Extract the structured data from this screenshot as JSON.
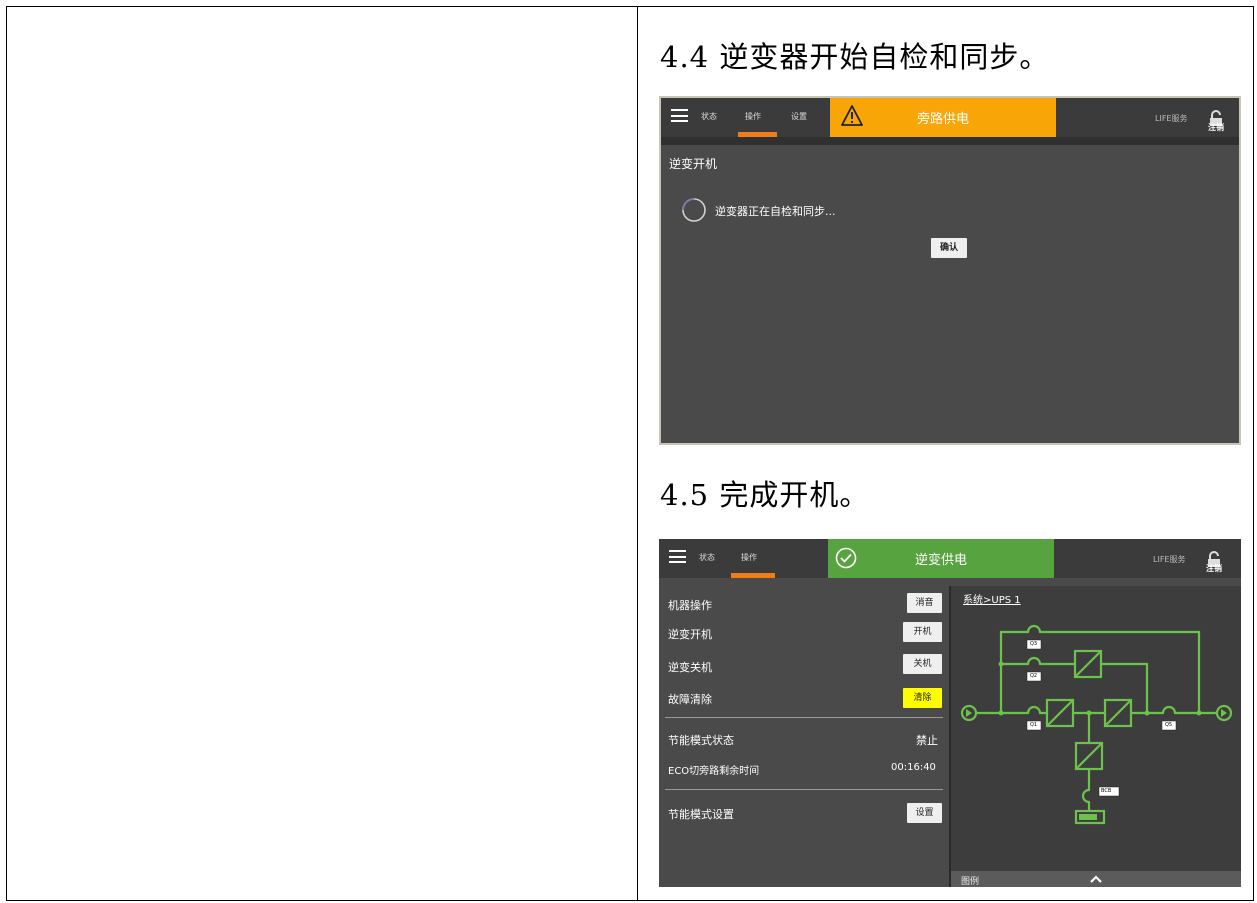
{
  "steps": [
    {
      "heading": "4.4 逆变器开始自检和同步。"
    },
    {
      "heading": "4.5 完成开机。"
    }
  ],
  "screen1": {
    "nav": {
      "status": "状态",
      "operation": "操作",
      "settings": "设置"
    },
    "banner": {
      "text": "旁路供电",
      "icon": "warning-triangle-icon",
      "color": "#f8a507"
    },
    "life_service": "LIFE服务",
    "logout": "注销",
    "page_title": "逆变开机",
    "progress_message": "逆变器正在自检和同步...",
    "confirm_label": "确认"
  },
  "screen2": {
    "nav": {
      "status": "状态",
      "operation": "操作"
    },
    "banner": {
      "text": "逆变供电",
      "icon": "check-circle-icon",
      "color": "#57a33f"
    },
    "life_service": "LIFE服务",
    "logout": "注销",
    "rows": [
      {
        "label": "机器操作",
        "button": "消音"
      },
      {
        "label": "逆变开机",
        "button": "开机"
      },
      {
        "label": "逆变关机",
        "button": "关机"
      },
      {
        "label": "故障清除",
        "button": "清除",
        "highlight": "#ffff00"
      }
    ],
    "eco_status_label": "节能模式状态",
    "eco_status_value": "禁止",
    "eco_time_label": "ECO切旁路剩余时间",
    "eco_time_value": "00:16:40",
    "eco_setting_label": "节能模式设置",
    "eco_setting_button": "设置",
    "breadcrumb_root": "系统",
    "breadcrumb_sep": ">",
    "breadcrumb_current": "UPS 1",
    "diagram_labels": {
      "q3": "Q3",
      "q2": "Q2",
      "q1": "Q1",
      "q5": "Q5",
      "bcb": "BCB"
    },
    "legend_label": "图例",
    "accent_color": "#6cc24a"
  }
}
